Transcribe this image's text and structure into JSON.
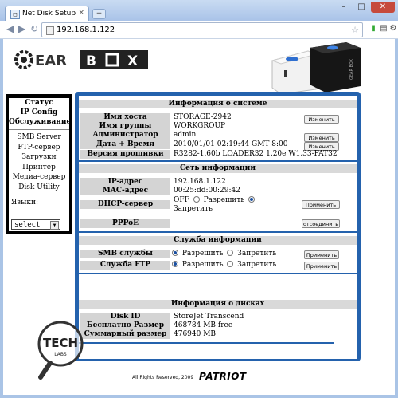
{
  "browser": {
    "tab_title": "Net Disk Setup",
    "tab_close": "×",
    "new_tab": "+",
    "window_controls": {
      "minimize": "–",
      "maximize": "□",
      "close": "✕"
    },
    "back": "◀",
    "forward": "▶",
    "reload": "↻",
    "url": "192.168.1.122",
    "star": "☆"
  },
  "brand": {
    "logo_text": "GEAR BOX",
    "product_label": "GEAR BOX",
    "footer": "All Rights Reserved, 2009",
    "patriot": "PATRIOT",
    "watermark_text": "TECH",
    "watermark_sub": "LABS"
  },
  "sidebar": {
    "primary": [
      "Статус",
      "IP Config",
      "Обслуживание"
    ],
    "secondary": [
      "SMB Server",
      "FTP-сервер",
      "Загрузки",
      "Принтер",
      "Медиа-сервер",
      "Disk Utility"
    ],
    "lang_label": "Языки:",
    "lang_value": "select"
  },
  "system_info": {
    "title": "Информация о системе",
    "rows": [
      {
        "label": "Имя хоста",
        "value": "STORAGE-2942",
        "button": "Изменить"
      },
      {
        "label": "Имя группы",
        "value": "WORKGROUP",
        "button": ""
      },
      {
        "label": "Администратор",
        "value": "admin",
        "button": "Изменить"
      },
      {
        "label": "Дата + Время",
        "value": "2010/01/01 02:19:44 GMT 8:00",
        "button": "Изменить"
      },
      {
        "label": "Версия прошивки",
        "value": "R3282-1.60b LOADER32 1.20e W1.33-FAT32",
        "button": ""
      }
    ]
  },
  "network": {
    "title": "Сеть информации",
    "ip_label": "IP-адрес",
    "ip_value": "192.168.1.122",
    "mac_label": "MAC-адрес",
    "mac_value": "00:25:dd:00:29:42",
    "dhcp_label": "DHCP-сервер",
    "dhcp_off": "OFF",
    "dhcp_allow": "Разрешить",
    "dhcp_deny": "Запретить",
    "apply": "Применить",
    "pppoe_label": "PPPoE",
    "pppoe_button": "отсоединить"
  },
  "services": {
    "title": "Служба информации",
    "smb_label": "SMB службы",
    "ftp_label": "Служба FTP",
    "allow": "Разрешить",
    "deny": "Запретить",
    "apply": "Применить"
  },
  "disks": {
    "title": "Информация о дисках",
    "rows": [
      {
        "label": "Disk ID",
        "value": "StoreJet Transcend"
      },
      {
        "label": "Бесплатно Размер",
        "value": "468784 MB free"
      },
      {
        "label": "Суммарный размер",
        "value": "476940 MB"
      }
    ]
  }
}
